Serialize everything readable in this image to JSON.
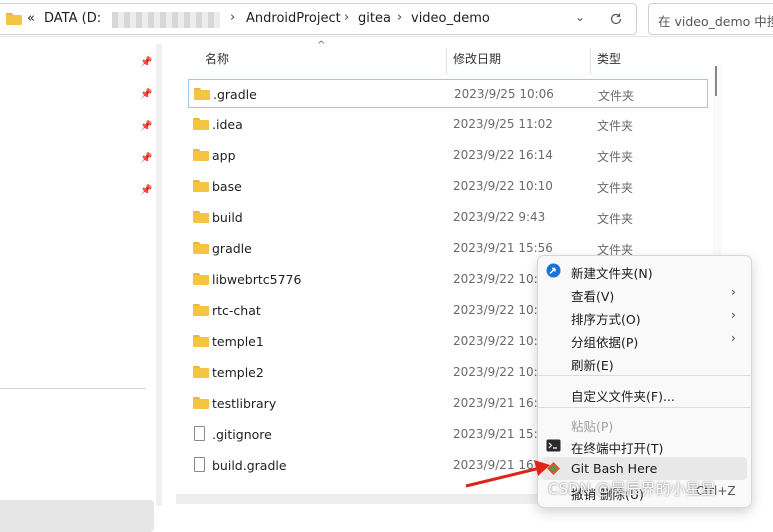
{
  "address": {
    "overflow": "«",
    "drive": "DATA (D:",
    "crumbs": [
      "AndroidProject",
      "gitea",
      "video_demo"
    ],
    "search_placeholder": "在 video_demo 中搜索"
  },
  "columns": {
    "name": "名称",
    "date": "修改日期",
    "type": "类型"
  },
  "files": [
    {
      "name": ".gradle",
      "date": "2023/9/25 10:06",
      "type": "文件夹",
      "kind": "folder"
    },
    {
      "name": ".idea",
      "date": "2023/9/25 11:02",
      "type": "文件夹",
      "kind": "folder"
    },
    {
      "name": "app",
      "date": "2023/9/22 16:14",
      "type": "文件夹",
      "kind": "folder"
    },
    {
      "name": "base",
      "date": "2023/9/22 10:10",
      "type": "文件夹",
      "kind": "folder"
    },
    {
      "name": "build",
      "date": "2023/9/22 9:43",
      "type": "文件夹",
      "kind": "folder"
    },
    {
      "name": "gradle",
      "date": "2023/9/21 15:56",
      "type": "文件夹",
      "kind": "folder"
    },
    {
      "name": "libwebrtc5776",
      "date": "2023/9/22 10:",
      "type": "",
      "kind": "folder"
    },
    {
      "name": "rtc-chat",
      "date": "2023/9/22 10:",
      "type": "",
      "kind": "folder"
    },
    {
      "name": "temple1",
      "date": "2023/9/22 10:",
      "type": "",
      "kind": "folder"
    },
    {
      "name": "temple2",
      "date": "2023/9/22 10:",
      "type": "",
      "kind": "folder"
    },
    {
      "name": "testlibrary",
      "date": "2023/9/21 16:",
      "type": "",
      "kind": "folder"
    },
    {
      "name": ".gitignore",
      "date": "2023/9/21 15:",
      "type": "",
      "kind": "file"
    },
    {
      "name": "build.gradle",
      "date": "2023/9/21 16:",
      "type": "",
      "kind": "file"
    }
  ],
  "context_menu": {
    "items": [
      {
        "label": "新建文件夹(N)",
        "icon": "new-folder-icon",
        "arrow": false,
        "disabled": false
      },
      {
        "label": "查看(V)",
        "icon": "",
        "arrow": true,
        "disabled": false
      },
      {
        "label": "排序方式(O)",
        "icon": "",
        "arrow": true,
        "disabled": false
      },
      {
        "label": "分组依据(P)",
        "icon": "",
        "arrow": true,
        "disabled": false
      },
      {
        "label": "刷新(E)",
        "icon": "",
        "arrow": false,
        "disabled": false
      },
      {
        "label": "自定义文件夹(F)...",
        "icon": "",
        "arrow": false,
        "disabled": false
      },
      {
        "label": "粘贴(P)",
        "icon": "",
        "arrow": false,
        "disabled": true
      },
      {
        "label": "在终端中打开(T)",
        "icon": "terminal-icon",
        "arrow": false,
        "disabled": false
      },
      {
        "label": "Git Bash Here",
        "icon": "git-icon",
        "arrow": false,
        "disabled": false,
        "highlighted": true
      },
      {
        "label": "撤销 删除(U)",
        "shortcut": "Ctrl+Z",
        "icon": "",
        "arrow": false,
        "disabled": false
      }
    ]
  },
  "watermark": "CSDN @晨辰界的小星星",
  "accent_color": "#9fc8ef",
  "arrow_color": "#e0241b"
}
